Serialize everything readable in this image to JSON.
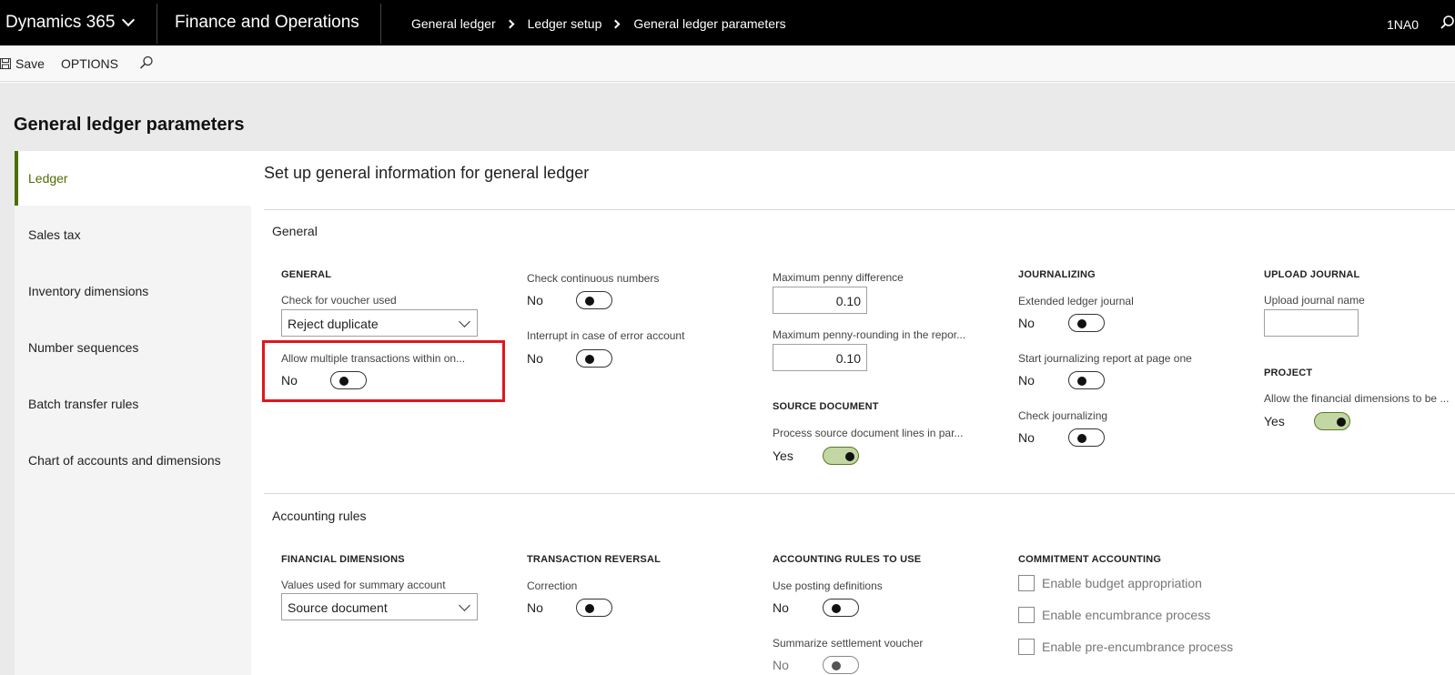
{
  "topbar": {
    "brand": "Dynamics 365",
    "app": "Finance and Operations",
    "breadcrumb": [
      "General ledger",
      "Ledger setup",
      "General ledger parameters"
    ],
    "company": "1NA0"
  },
  "actions": {
    "save": "Save",
    "options": "OPTIONS"
  },
  "page": {
    "title": "General ledger parameters",
    "content_title": "Set up general information for general ledger"
  },
  "tabs": [
    {
      "label": "Ledger",
      "active": true
    },
    {
      "label": "Sales tax"
    },
    {
      "label": "Inventory dimensions"
    },
    {
      "label": "Number sequences"
    },
    {
      "label": "Batch transfer rules"
    },
    {
      "label": "Chart of accounts and dimensions"
    }
  ],
  "general": {
    "section": "General",
    "general_group": "GENERAL",
    "voucher_label": "Check for voucher used",
    "voucher_value": "Reject duplicate",
    "multi_label": "Allow multiple transactions within on...",
    "multi_value": "No",
    "continuous_label": "Check continuous numbers",
    "continuous_value": "No",
    "interrupt_label": "Interrupt in case of error account",
    "interrupt_value": "No",
    "penny_diff_label": "Maximum penny difference",
    "penny_diff_value": "0.10",
    "penny_round_label": "Maximum penny-rounding in the repor...",
    "penny_round_value": "0.10",
    "source_group": "SOURCE DOCUMENT",
    "process_label": "Process source document lines in par...",
    "process_value": "Yes",
    "journalizing_group": "JOURNALIZING",
    "extended_label": "Extended ledger journal",
    "extended_value": "No",
    "startjournal_label": "Start journalizing report at page one",
    "startjournal_value": "No",
    "checkjournal_label": "Check journalizing",
    "checkjournal_value": "No",
    "upload_group": "UPLOAD JOURNAL",
    "upload_label": "Upload journal name",
    "project_group": "PROJECT",
    "findim_label": "Allow the financial dimensions to be ...",
    "findim_value": "Yes"
  },
  "accounting": {
    "section": "Accounting rules",
    "fin_group": "FINANCIAL DIMENSIONS",
    "summary_label": "Values used for summary account",
    "summary_value": "Source document",
    "reversal_group": "TRANSACTION REVERSAL",
    "correction_label": "Correction",
    "correction_value": "No",
    "rules_group": "ACCOUNTING RULES TO USE",
    "posting_label": "Use posting definitions",
    "posting_value": "No",
    "summarize_label": "Summarize settlement voucher",
    "summarize_value": "No",
    "commit_group": "COMMITMENT ACCOUNTING",
    "budget_label": "Enable budget appropriation",
    "encumbrance_label": "Enable encumbrance process",
    "preenc_label": "Enable pre-encumbrance process"
  }
}
